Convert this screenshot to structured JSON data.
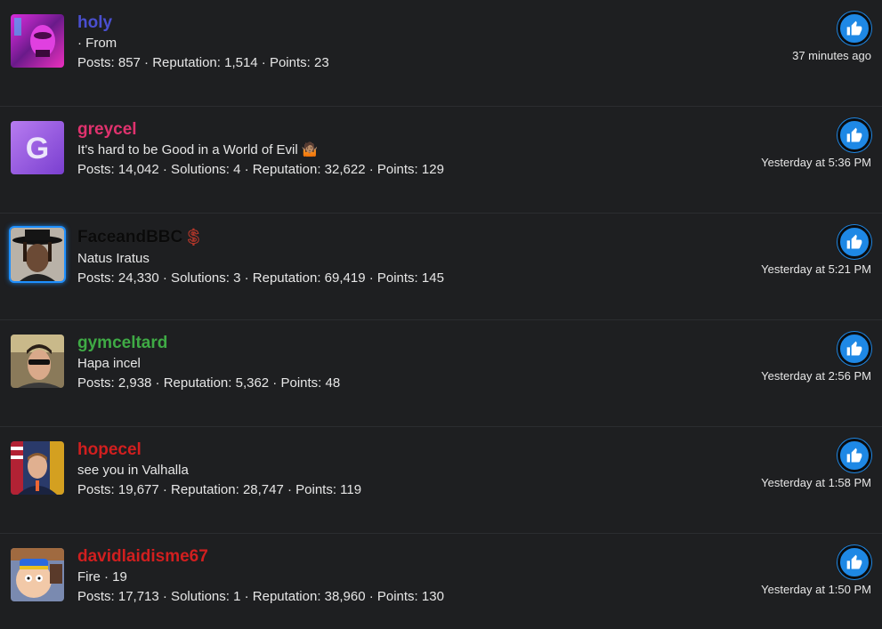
{
  "rows": [
    {
      "username": "holy",
      "username_color": "#4a4fd0",
      "title": " · From",
      "stats": "Posts: 857 · Reputation: 1,514 · Points: 23",
      "time": "37 minutes ago",
      "avatar": "avatar-magenta-portrait"
    },
    {
      "username": "greycel",
      "username_color": "#e0326e",
      "title": "It's hard to be Good in a World of Evil 🤷🏽",
      "stats": "Posts: 14,042 · Solutions: 4 · Reputation: 32,622 · Points: 129",
      "time": "Yesterday at 5:36 PM",
      "avatar": "avatar-letter-g",
      "avatar_letter": "G"
    },
    {
      "username": "FaceandBBC",
      "username_color": "#0a0a0a",
      "badge": "$",
      "title": "Natus Iratus",
      "stats": "Posts: 24,330 · Solutions: 3 · Reputation: 69,419 · Points: 145",
      "time": "Yesterday at 5:21 PM",
      "avatar": "avatar-hat-portrait"
    },
    {
      "username": "gymceltard",
      "username_color": "#3faa45",
      "title": "Hapa incel",
      "stats": "Posts: 2,938 · Reputation: 5,362 · Points: 48",
      "time": "Yesterday at 2:56 PM",
      "avatar": "avatar-sunglasses-portrait"
    },
    {
      "username": "hopecel",
      "username_color": "#d11f1f",
      "title": "see you in Valhalla",
      "stats": "Posts: 19,677 · Reputation: 28,747 · Points: 119",
      "time": "Yesterday at 1:58 PM",
      "avatar": "avatar-flag-portrait"
    },
    {
      "username": "davidlaidisme67",
      "username_color": "#d11f1f",
      "title": "Fire · 19",
      "stats": "Posts: 17,713 · Solutions: 1 · Reputation: 38,960 · Points: 130",
      "time": "Yesterday at 1:50 PM",
      "avatar": "avatar-cartoon-portrait"
    }
  ],
  "like_icon": "thumbs-up-icon",
  "colors": {
    "background": "#1e1f21",
    "like_blue": "#1e88e5"
  }
}
